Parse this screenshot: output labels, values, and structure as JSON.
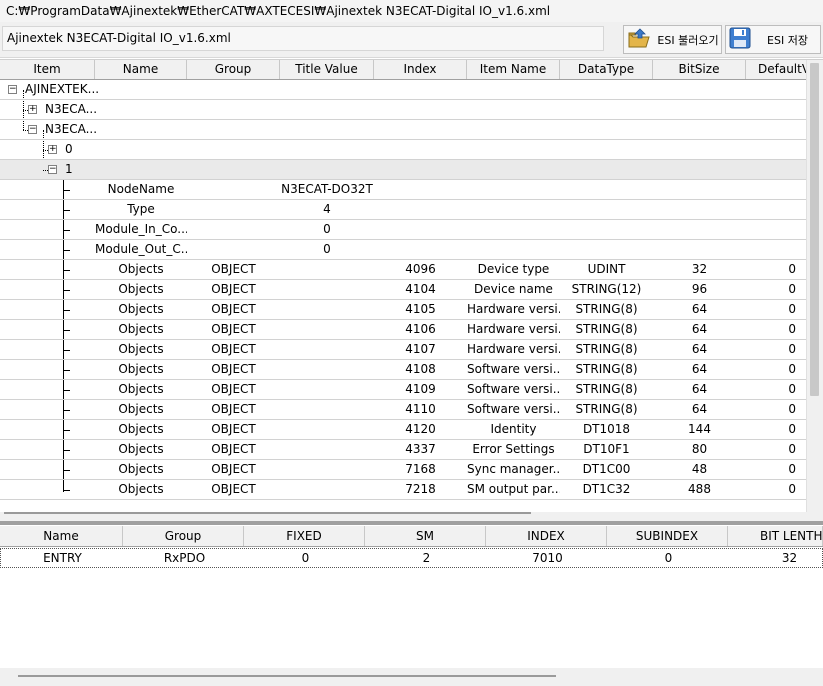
{
  "window": {
    "path": "C:₩ProgramData₩Ajinextek₩EtherCAT₩AXTECESI₩Ajinextek N3ECAT-Digital IO_v1.6.xml"
  },
  "toolbar": {
    "filename": "Ajinextek N3ECAT-Digital IO_v1.6.xml",
    "load_label": "ESI 불러오기",
    "save_label": "ESI 저장",
    "load_icon": "folder-open-arrow-icon",
    "save_icon": "floppy-disk-icon"
  },
  "tree_grid": {
    "columns": [
      "Item",
      "Name",
      "Group",
      "Title Value",
      "Index",
      "Item Name",
      "DataType",
      "BitSize",
      "DefaultVa"
    ],
    "nodes": [
      {
        "label": "AJINEXTEK...",
        "expander": "⊟"
      },
      {
        "label": "N3ECA...",
        "expander": "⊞"
      },
      {
        "label": "N3ECA...",
        "expander": "⊟"
      },
      {
        "label": "0",
        "expander": "⊞"
      },
      {
        "label": "1",
        "expander": "⊟"
      }
    ],
    "props": [
      {
        "name": "NodeName",
        "value": "N3ECAT-DO32T"
      },
      {
        "name": "Type",
        "value": "4"
      },
      {
        "name": "Module_In_Co...",
        "value": "0"
      },
      {
        "name": "Module_Out_C...",
        "value": "0"
      }
    ],
    "objects": [
      {
        "name": "Objects",
        "group": "OBJECT",
        "index": "4096",
        "item_name": "Device type",
        "datatype": "UDINT",
        "bitsize": "32",
        "default": "0"
      },
      {
        "name": "Objects",
        "group": "OBJECT",
        "index": "4104",
        "item_name": "Device name",
        "datatype": "STRING(12)",
        "bitsize": "96",
        "default": "0"
      },
      {
        "name": "Objects",
        "group": "OBJECT",
        "index": "4105",
        "item_name": "Hardware versi...",
        "datatype": "STRING(8)",
        "bitsize": "64",
        "default": "0"
      },
      {
        "name": "Objects",
        "group": "OBJECT",
        "index": "4106",
        "item_name": "Hardware versi...",
        "datatype": "STRING(8)",
        "bitsize": "64",
        "default": "0"
      },
      {
        "name": "Objects",
        "group": "OBJECT",
        "index": "4107",
        "item_name": "Hardware versi...",
        "datatype": "STRING(8)",
        "bitsize": "64",
        "default": "0"
      },
      {
        "name": "Objects",
        "group": "OBJECT",
        "index": "4108",
        "item_name": "Software versi...",
        "datatype": "STRING(8)",
        "bitsize": "64",
        "default": "0"
      },
      {
        "name": "Objects",
        "group": "OBJECT",
        "index": "4109",
        "item_name": "Software versi...",
        "datatype": "STRING(8)",
        "bitsize": "64",
        "default": "0"
      },
      {
        "name": "Objects",
        "group": "OBJECT",
        "index": "4110",
        "item_name": "Software versi...",
        "datatype": "STRING(8)",
        "bitsize": "64",
        "default": "0"
      },
      {
        "name": "Objects",
        "group": "OBJECT",
        "index": "4120",
        "item_name": "Identity",
        "datatype": "DT1018",
        "bitsize": "144",
        "default": "0"
      },
      {
        "name": "Objects",
        "group": "OBJECT",
        "index": "4337",
        "item_name": "Error Settings",
        "datatype": "DT10F1",
        "bitsize": "80",
        "default": "0"
      },
      {
        "name": "Objects",
        "group": "OBJECT",
        "index": "7168",
        "item_name": "Sync manager...",
        "datatype": "DT1C00",
        "bitsize": "48",
        "default": "0"
      },
      {
        "name": "Objects",
        "group": "OBJECT",
        "index": "7218",
        "item_name": "SM output par...",
        "datatype": "DT1C32",
        "bitsize": "488",
        "default": "0"
      }
    ]
  },
  "entry_grid": {
    "columns": [
      "Name",
      "Group",
      "FIXED",
      "SM",
      "INDEX",
      "SUBINDEX",
      "BIT LENTH"
    ],
    "rows": [
      {
        "name": "ENTRY",
        "group": "RxPDO",
        "fixed": "0",
        "sm": "2",
        "index": "7010",
        "subindex": "0",
        "bit_length": "32"
      }
    ]
  }
}
